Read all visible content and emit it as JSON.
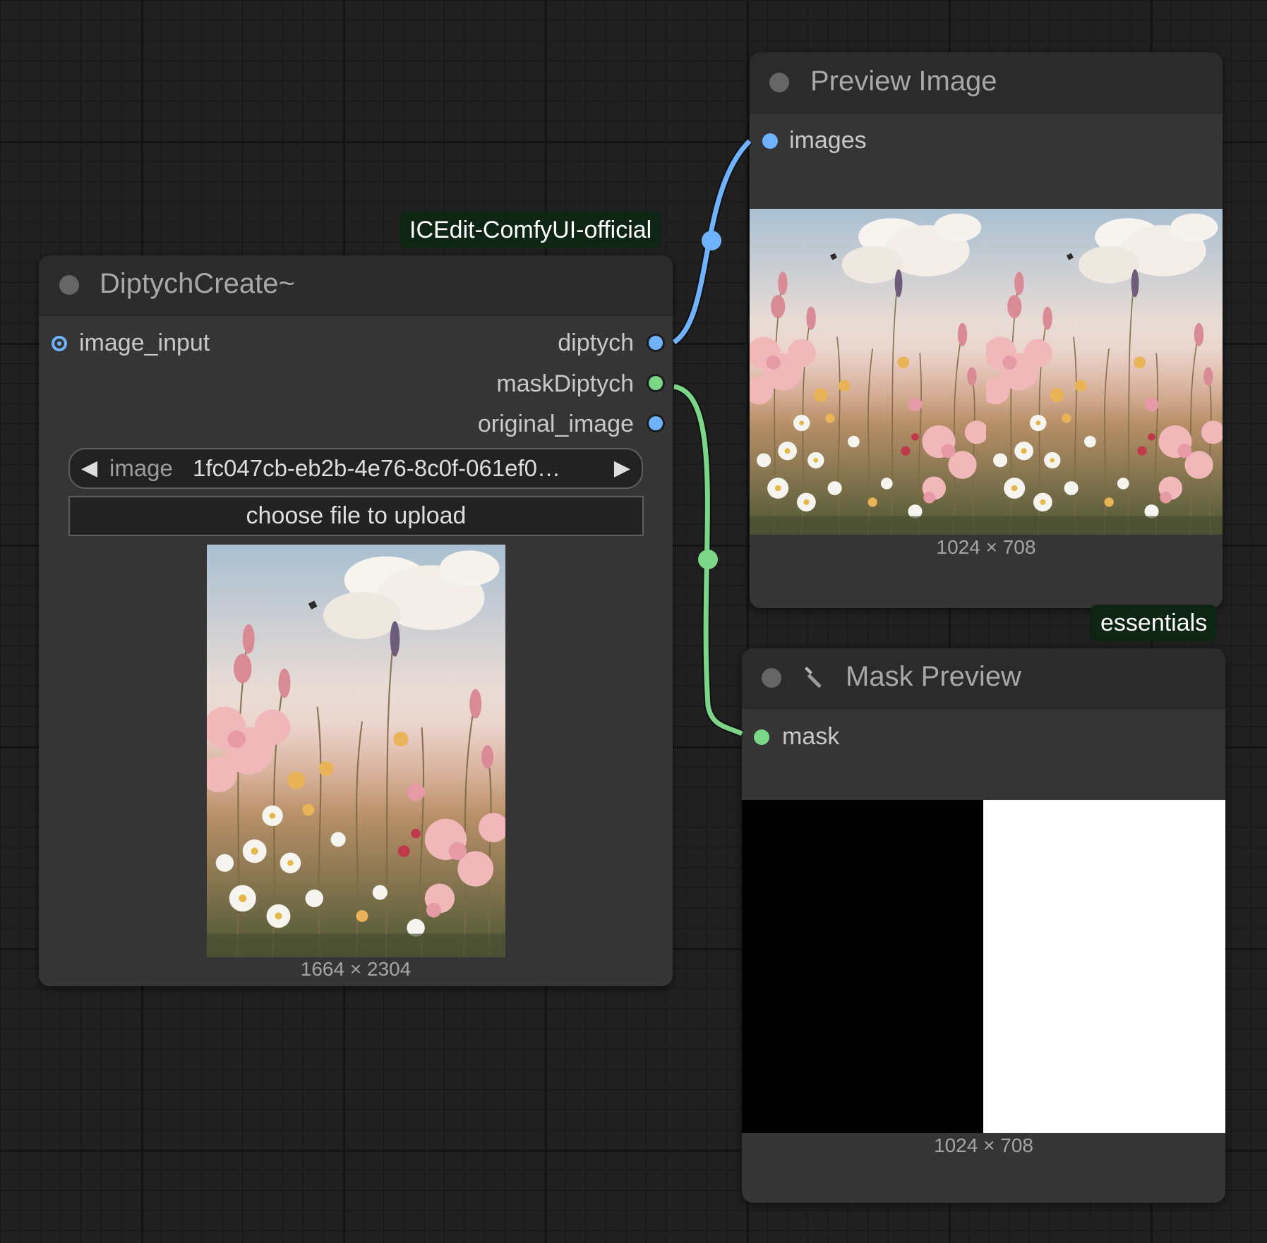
{
  "groups": {
    "icedit_label": "ICEdit-ComfyUI-official",
    "essentials_label": "essentials"
  },
  "diptych_node": {
    "title": "DiptychCreate~",
    "input_label": "image_input",
    "outputs": [
      "diptych",
      "maskDiptych",
      "original_image"
    ],
    "image_widget": {
      "label": "image",
      "value": "1fc047cb-eb2b-4e76-8c0f-061ef0…"
    },
    "upload_label": "choose file to upload",
    "preview_dims": "1664 × 2304"
  },
  "preview_node": {
    "title": "Preview Image",
    "input_label": "images",
    "preview_dims": "1024 × 708"
  },
  "mask_node": {
    "title": "Mask Preview",
    "title_icon": "wrench-icon",
    "input_label": "mask",
    "preview_dims": "1024 × 708"
  },
  "colors": {
    "image_link": "#6fb2ff",
    "mask_link": "#7cd687",
    "canvas": "#202020",
    "node_body": "#353535",
    "node_header": "#2b2b2b",
    "group_badge": "#0e2514"
  }
}
